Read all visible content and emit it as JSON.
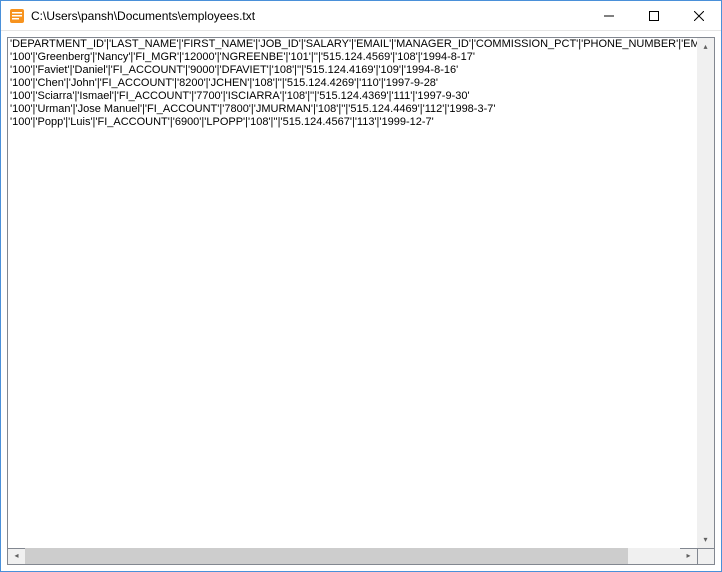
{
  "window": {
    "title": "C:\\Users\\pansh\\Documents\\employees.txt"
  },
  "file_content": {
    "lines": [
      "'DEPARTMENT_ID'|'LAST_NAME'|'FIRST_NAME'|'JOB_ID'|'SALARY'|'EMAIL'|'MANAGER_ID'|'COMMISSION_PCT'|'PHONE_NUMBER'|'EMPLOYEE_ID'|'H",
      "'100'|'Greenberg'|'Nancy'|'FI_MGR'|'12000'|'NGREENBE'|'101'|''|'515.124.4569'|'108'|'1994-8-17'",
      "'100'|'Faviet'|'Daniel'|'FI_ACCOUNT'|'9000'|'DFAVIET'|'108'|''|'515.124.4169'|'109'|'1994-8-16'",
      "'100'|'Chen'|'John'|'FI_ACCOUNT'|'8200'|'JCHEN'|'108'|''|'515.124.4269'|'110'|'1997-9-28'",
      "'100'|'Sciarra'|'Ismael'|'FI_ACCOUNT'|'7700'|'ISCIARRA'|'108'|''|'515.124.4369'|'111'|'1997-9-30'",
      "'100'|'Urman'|'Jose Manuel'|'FI_ACCOUNT'|'7800'|'JMURMAN'|'108'|''|'515.124.4469'|'112'|'1998-3-7'",
      "'100'|'Popp'|'Luis'|'FI_ACCOUNT'|'6900'|'LPOPP'|'108'|''|'515.124.4567'|'113'|'1999-12-7'"
    ]
  }
}
